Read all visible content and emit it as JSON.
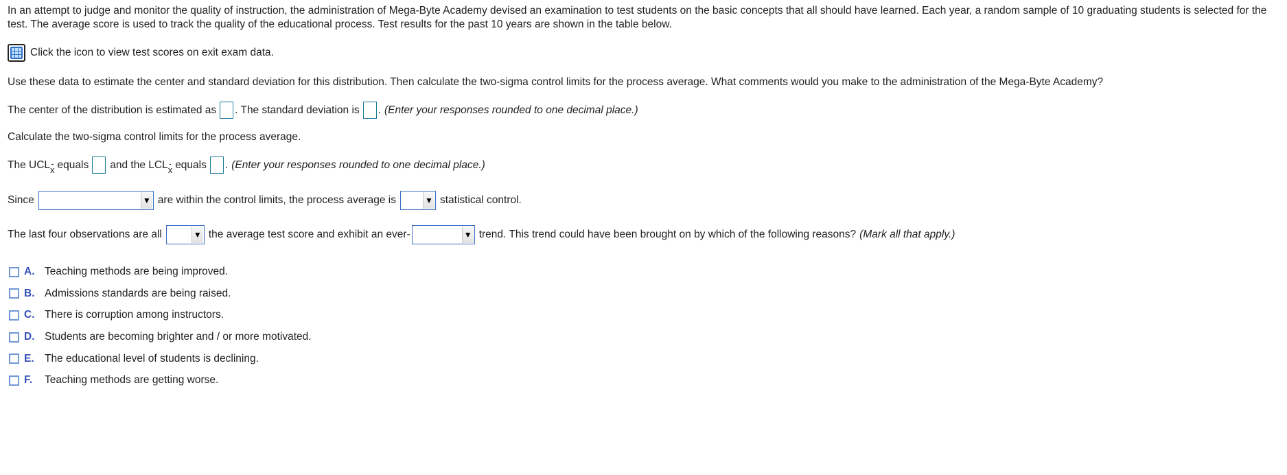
{
  "problem": {
    "intro": "In an attempt to judge and monitor the quality of instruction, the administration of Mega-Byte Academy devised an examination to test students on the basic concepts that all should have learned. Each year, a random sample of 10 graduating students is selected for the test. The average score is used to track the quality of the educational process. Test results for the past 10 years are shown in the table below.",
    "data_link": {
      "icon": "table-grid-icon",
      "label": "Click the icon to view test scores on exit exam data."
    },
    "instructions": "Use these data to estimate the center and standard deviation for this distribution. Then calculate the two-sigma control limits for the process average. What comments would you make to the administration of the Mega-Byte Academy?"
  },
  "center_line": {
    "text1": "The center of the distribution is estimated as",
    "center_value": "",
    "text2": ". The standard deviation is",
    "sd_value": "",
    "text3": ".",
    "hint": "(Enter your responses rounded to one decimal place.)"
  },
  "limits_heading": "Calculate the two-sigma control limits for the process average.",
  "limits_line": {
    "text1": "The UCL",
    "sub": "x",
    "text2": "equals",
    "ucl_value": "",
    "text3": "and the LCL",
    "text4": "equals",
    "lcl_value": "",
    "text5": ".",
    "hint": "(Enter your responses rounded to one decimal place.)"
  },
  "since_line": {
    "text1": "Since",
    "select1_value": "",
    "text2": "are within the control limits, the process average is",
    "select2_value": "",
    "text3": "statistical control."
  },
  "trend_line": {
    "text1": "The last four observations are all",
    "select1_value": "",
    "text2": "the average test score and exhibit an ever-",
    "select2_value": "",
    "text3": "trend. This trend could have been brought on by which of the following reasons?",
    "hint": "(Mark all that apply.)"
  },
  "choices": [
    {
      "letter": "A.",
      "text": "Teaching methods are being improved.",
      "checked": false
    },
    {
      "letter": "B.",
      "text": "Admissions standards are being raised.",
      "checked": false
    },
    {
      "letter": "C.",
      "text": "There is corruption among instructors.",
      "checked": false
    },
    {
      "letter": "D.",
      "text": "Students are becoming brighter and / or more motivated.",
      "checked": false
    },
    {
      "letter": "E.",
      "text": "The educational level of students is declining.",
      "checked": false
    },
    {
      "letter": "F.",
      "text": "Teaching methods are getting worse.",
      "checked": false
    }
  ],
  "dropdown_arrow": "▼"
}
